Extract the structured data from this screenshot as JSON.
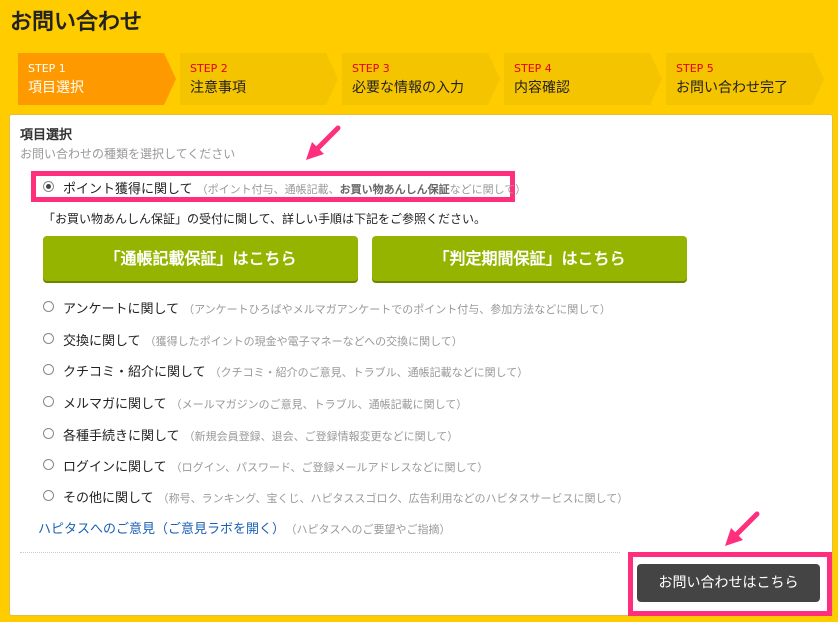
{
  "page": {
    "title": "お問い合わせ"
  },
  "steps": [
    {
      "num": "STEP 1",
      "label": "項目選択",
      "active": true
    },
    {
      "num": "STEP 2",
      "label": "注意事項",
      "active": false
    },
    {
      "num": "STEP 3",
      "label": "必要な情報の入力",
      "active": false
    },
    {
      "num": "STEP 4",
      "label": "内容確認",
      "active": false
    },
    {
      "num": "STEP 5",
      "label": "お問い合わせ完了",
      "active": false
    }
  ],
  "section": {
    "title": "項目選択",
    "subtitle": "お問い合わせの種類を選択してください"
  },
  "selected_option": {
    "label": "ポイント獲得に関して",
    "note_open": "（ポイント付与、通帳記載、",
    "note_bold": "お買い物あんしん保証",
    "note_close": "などに関して）"
  },
  "info_text": "「お買い物あんしん保証」の受付に関して、詳しい手順は下記をご参照ください。",
  "buttons": {
    "passbook": "「通帳記載保証」はこちら",
    "judgement": "「判定期間保証」はこちら",
    "submit": "お問い合わせはこちら"
  },
  "options": [
    {
      "label": "アンケートに関して",
      "note": "（アンケートひろばやメルマガアンケートでのポイント付与、参加方法などに関して）"
    },
    {
      "label": "交換に関して",
      "note": "（獲得したポイントの現金や電子マネーなどへの交換に関して）"
    },
    {
      "label": "クチコミ・紹介に関して",
      "note": "（クチコミ・紹介のご意見、トラブル、通帳記載などに関して）"
    },
    {
      "label": "メルマガに関して",
      "note": "（メールマガジンのご意見、トラブル、通帳記載に関して）"
    },
    {
      "label": "各種手続きに関して",
      "note": "（新規会員登録、退会、ご登録情報変更などに関して）"
    },
    {
      "label": "ログインに関して",
      "note": "（ログイン、パスワード、ご登録メールアドレスなどに関して）"
    },
    {
      "label": "その他に関して",
      "note": "（称号、ランキング、宝くじ、ハピタススゴロク、広告利用などのハピタスサービスに関して）"
    }
  ],
  "feedback": {
    "link": "ハピタスへのご意見（ご意見ラボを開く）",
    "note": "（ハピタスへのご要望やご指摘）"
  },
  "colors": {
    "background": "#ffcc00",
    "step_active": "#ff9900",
    "step_inactive": "#f5c400",
    "step_number": "#e60012",
    "green_button": "#95b400",
    "highlight": "#ff2f7d",
    "submit_button": "#444444",
    "link": "#1a5fb4"
  }
}
